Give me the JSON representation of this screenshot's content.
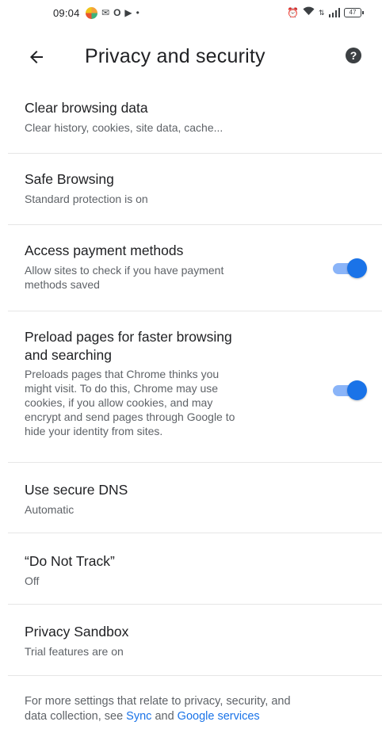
{
  "status_bar": {
    "time": "09:04",
    "battery": "47",
    "left_icons": [
      "app-icon",
      "mail-icon",
      "circle-icon",
      "play-icon",
      "dot-icon"
    ],
    "right_icons": [
      "alarm-icon",
      "wifi-icon",
      "data-icon",
      "signal-icon",
      "battery-icon"
    ]
  },
  "header": {
    "title": "Privacy and security",
    "back_icon": "arrow-left-icon",
    "help_icon": "help-icon",
    "help_glyph": "?"
  },
  "settings": [
    {
      "title": "Clear browsing data",
      "subtitle": "Clear history, cookies, site data, cache..."
    },
    {
      "title": "Safe Browsing",
      "subtitle": "Standard protection is on"
    },
    {
      "title": "Access payment methods",
      "subtitle_lines": [
        "Allow sites to check if you have payment",
        "methods saved"
      ],
      "toggle": true
    },
    {
      "title_lines": [
        "Preload pages for faster browsing",
        "and searching"
      ],
      "subtitle_lines": [
        "Preloads pages that Chrome thinks you",
        "might visit. To do this, Chrome may use",
        "cookies, if you allow cookies, and may",
        "encrypt and send pages through Google to",
        "hide your identity from sites."
      ],
      "toggle": true
    },
    {
      "title": "Use secure DNS",
      "subtitle": "Automatic"
    },
    {
      "title": "“Do Not Track”",
      "subtitle": "Off"
    },
    {
      "title": "Privacy Sandbox",
      "subtitle": "Trial features are on"
    }
  ],
  "footer": {
    "line1": "For more settings that relate to privacy, security, and",
    "line2_prefix": "data collection, see ",
    "link_sync": "Sync",
    "and": " and ",
    "link_services": "Google services"
  },
  "colors": {
    "accent": "#1a73e8",
    "toggle_track": "#8ab4f8"
  }
}
